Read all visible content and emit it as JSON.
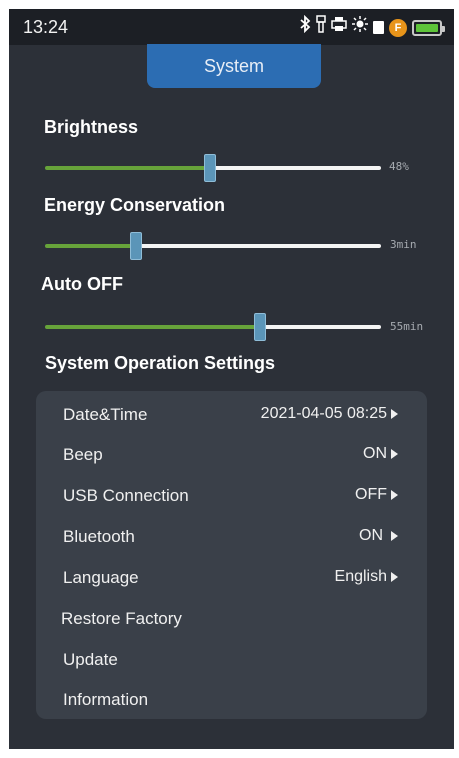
{
  "statusbar": {
    "time": "13:24",
    "icons": [
      "bluetooth-icon",
      "flashlight-icon",
      "printer-icon",
      "sun-icon",
      "sd-card-icon",
      "f-coin-icon",
      "battery-icon"
    ],
    "coin_letter": "F",
    "battery_color": "#5ec43a"
  },
  "header": {
    "tab_label": "System"
  },
  "sliders": {
    "brightness": {
      "label": "Brightness",
      "value_text": "48%",
      "level": 0.49
    },
    "energy": {
      "label": "Energy Conservation",
      "value_text": "3min",
      "level": 0.27
    },
    "auto_off": {
      "label": "Auto OFF",
      "value_text": "55min",
      "level": 0.64
    }
  },
  "settings": {
    "title": "System Operation Settings",
    "rows": [
      {
        "label": "Date&Time",
        "value": "2021-04-05 08:25"
      },
      {
        "label": "Beep",
        "value": "ON"
      },
      {
        "label": "USB Connection",
        "value": "OFF"
      },
      {
        "label": "Bluetooth",
        "value": "ON"
      },
      {
        "label": "Language",
        "value": "English"
      },
      {
        "label": "Restore Factory",
        "value": ""
      },
      {
        "label": "Update",
        "value": ""
      },
      {
        "label": "Information",
        "value": ""
      }
    ]
  },
  "colors": {
    "accent_tab": "#2c6db3",
    "slider_active": "#67a33a",
    "screen_bg": "#2c3038"
  }
}
